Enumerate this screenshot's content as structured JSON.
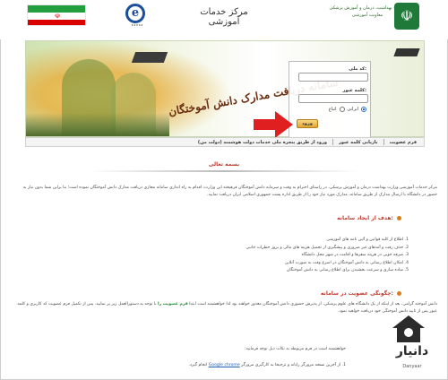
{
  "header": {
    "center_title": "مرکز خدمات آموزشی",
    "ministry_line1": "وزارت بهداشت، درمان و آموزش پزشکی",
    "ministry_line2": "معاونت آموزشی",
    "edu_logo_letter": "e",
    "flag_colors": [
      "#239f40",
      "#ffffff",
      "#da0000"
    ]
  },
  "banner": {
    "title": "سامانه دریافت مدارک دانش آموختگان"
  },
  "login": {
    "national_code_label": "کد ملی:",
    "password_label": "کلمه عبور:",
    "radio_iranian": "ایرانی",
    "radio_foreign": "اتباع",
    "selected": "ایرانی",
    "login_button": "ورود"
  },
  "nav": {
    "register": "فرم عضویت",
    "recover_password": "بازیابی کلمه عبور",
    "gov_login": "ورود از طریق پنجره ملی خدمات دولت هوشمند (دولت من)"
  },
  "content": {
    "title": "بسمه تعالی",
    "intro": "مرکز خدمات آموزشی وزارت بهداشت درمان و آموزش پزشکی، در راستای احترام به وقت و سرمایه دانش آموختگان فرهیخته این وزارت، اقدام به راه اندازی سامانه مجازی دریافت مدارک دانش آموختگان نموده است؛ بنا براین شما بدون نیاز به حضور در دانشگاه با ارسال مدارک از طریق سامانه، مدارک مورد نیاز خود را از طریق اداره پست جمهوری اسلامی ایران دریافت نمایید.",
    "goals_heading": "هدف از ایجاد سامانه:",
    "goals": [
      "1. اطلاع از کلیه قوانین و آئین نامه های آموزشی",
      "2. حذف رفت و آمدهای غیر ضروری و پیشگیری از تحمیل هزینه های مالی و بروز خطرات جانبی",
      "3. صرفه جویی در هزینه سفرها و اقامت در شهر محل دانشگاه",
      "4. امکان اطلاع رسانی به دانش آموختگان در اسرع وقت به صورت آنلاین",
      "5. ساده سازی و سرعت بخشیدن برای اطلاع رسانی به دانش آموختگان"
    ],
    "membership_heading": "چگونگی عضویت در سامانه:",
    "membership_text_before": "دانش آموخته گرامی، بعد از اینکه از یک دانشگاه های علوم پزشکی، از پذیرش حضوری دانش آموختگان معذور خواهند بود لذا خواهشمند است ابتدا",
    "membership_link": "فرم عضویت را",
    "membership_text_after": "با توجه به دستورالعمل زیر پر نمایید. پس از تکمیل فرم عضویت کد کاربری و کلمه عبور پس از تایید دانش آموختگی خود دریافت خواهید نمود.",
    "note_line": "خواهشمند است در فرم مربوطه به نکات ذیل توجه فرمایید:",
    "browser_note_before": "1. از آخرین نسخه مرورگر رایانه و ترجیحا به کارگیری مرورگر",
    "browser_link": "Google chrome",
    "browser_note_after": "انجام گیرد."
  },
  "watermark": {
    "brand": "دانیار",
    "sub": "Danyaar"
  }
}
